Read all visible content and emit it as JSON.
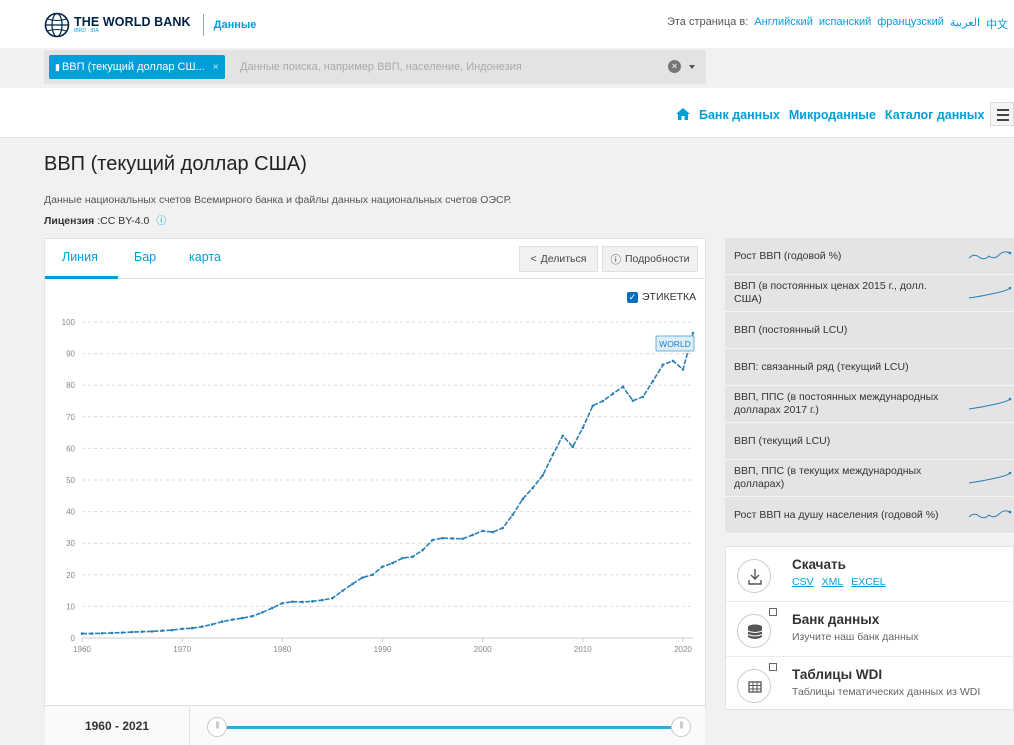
{
  "header": {
    "brand": "THE WORLD BANK",
    "brand_sub": "IBRD · IDA",
    "section": "Данные",
    "lang_prefix": "Эта страница в:",
    "languages": [
      "Английский",
      "испанский",
      "французский",
      "العربية",
      "中文"
    ]
  },
  "search": {
    "chip_label": "ВВП (текущий доллар СШ...",
    "placeholder": "Данные поиска, например ВВП, население, Индонезия"
  },
  "nav": {
    "links": [
      "Банк данных",
      "Микроданные",
      "Каталог данных"
    ]
  },
  "page": {
    "title": "ВВП (текущий доллар США)",
    "source": "Данные национальных счетов Всемирного банка и файлы данных национальных счетов ОЭСР.",
    "license_label": "Лицензия",
    "license_value": ":CC BY-4.0"
  },
  "chart_panel": {
    "tabs": [
      "Линия",
      "Бар",
      "карта"
    ],
    "active_tab": "Линия",
    "share_label": "Делиться",
    "details_label": "Подробности",
    "label_checkbox": "ЭТИКЕТКА",
    "label_checked": true,
    "range_from": "1960",
    "range_to": "2021"
  },
  "chart_data": {
    "type": "line",
    "series": [
      {
        "name": "WORLD",
        "color": "#2b7fb8",
        "x": [
          1960,
          1961,
          1962,
          1963,
          1964,
          1965,
          1966,
          1967,
          1968,
          1969,
          1970,
          1971,
          1972,
          1973,
          1974,
          1975,
          1976,
          1977,
          1978,
          1979,
          1980,
          1981,
          1982,
          1983,
          1984,
          1985,
          1986,
          1987,
          1988,
          1989,
          1990,
          1991,
          1992,
          1993,
          1994,
          1995,
          1996,
          1997,
          1998,
          1999,
          2000,
          2001,
          2002,
          2003,
          2004,
          2005,
          2006,
          2007,
          2008,
          2009,
          2010,
          2011,
          2012,
          2013,
          2014,
          2015,
          2016,
          2017,
          2018,
          2019,
          2020,
          2021
        ],
        "values": [
          1.4,
          1.4,
          1.5,
          1.6,
          1.7,
          1.9,
          2.0,
          2.1,
          2.3,
          2.5,
          2.9,
          3.1,
          3.6,
          4.3,
          5.2,
          5.8,
          6.3,
          6.9,
          8.1,
          9.5,
          11.0,
          11.5,
          11.4,
          11.6,
          12.0,
          12.6,
          14.9,
          17.1,
          19.1,
          20.0,
          22.6,
          23.7,
          25.3,
          25.7,
          27.8,
          31.0,
          31.6,
          31.5,
          31.4,
          32.6,
          33.9,
          33.5,
          34.8,
          39.0,
          44.0,
          47.5,
          51.5,
          58.0,
          64.0,
          60.5,
          66.5,
          73.5,
          75.0,
          77.3,
          79.5,
          75.1,
          76.3,
          81.3,
          86.5,
          87.7,
          85.0,
          96.5
        ]
      }
    ],
    "series_label": "WORLD",
    "xticks": [
      "1960",
      "1970",
      "1980",
      "1990",
      "2000",
      "2010",
      "2020"
    ],
    "yticks": [
      "0",
      "10",
      "20",
      "30",
      "40",
      "50",
      "60",
      "70",
      "80",
      "90",
      "100"
    ],
    "ylim": [
      0,
      100
    ],
    "xlim": [
      1960,
      2021
    ],
    "grid": true
  },
  "related": [
    {
      "label": "Рост ВВП (годовой %)",
      "spark": "wave"
    },
    {
      "label": "ВВП (в постоянных ценах 2015 г., долл. США)",
      "spark": "rise"
    },
    {
      "label": "ВВП (постоянный LCU)",
      "spark": "none"
    },
    {
      "label": "ВВП: связанный ряд (текущий LCU)",
      "spark": "none"
    },
    {
      "label": "ВВП, ППС (в постоянных международных долларах 2017 г.)",
      "spark": "rise"
    },
    {
      "label": "ВВП (текущий LCU)",
      "spark": "none"
    },
    {
      "label": "ВВП, ППС (в текущих международных долларах)",
      "spark": "rise"
    },
    {
      "label": "Рост ВВП на душу населения (годовой %)",
      "spark": "wave"
    }
  ],
  "cards": {
    "download": {
      "title": "Скачать",
      "formats": [
        "CSV",
        "XML",
        "EXCEL"
      ]
    },
    "databank": {
      "title": "Банк данных",
      "desc": "Изучите наш банк данных"
    },
    "wdi": {
      "title": "Таблицы WDI",
      "desc": "Таблицы тематических данных из WDI"
    }
  }
}
